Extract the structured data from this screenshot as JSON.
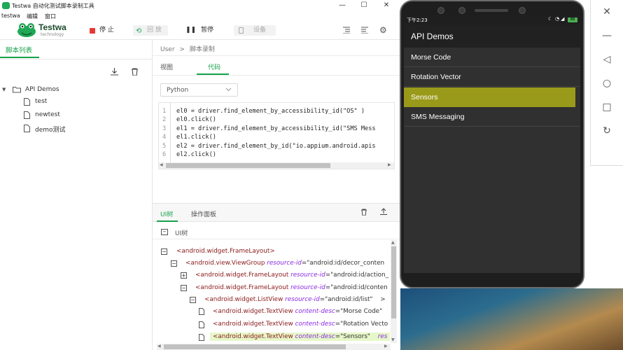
{
  "window": {
    "title": "Testwa 自动化测试脚本录制工具",
    "min_glyph": "—",
    "max_glyph": "☐",
    "close_glyph": "✕"
  },
  "menu": [
    "testwa",
    "编辑",
    "窗口"
  ],
  "logo": {
    "name": "Testwa",
    "sub": "technology"
  },
  "toolbar": {
    "stop": "停 止",
    "replay": "回 放",
    "pause": "暂停",
    "device": "设备"
  },
  "left": {
    "tab": "脚本列表",
    "tree_root": "API Demos",
    "files": [
      "test",
      "newtest",
      "demo测试"
    ]
  },
  "main": {
    "breadcrumb": {
      "root": "User",
      "sep": ">",
      "current": "脚本录制"
    },
    "tabs": [
      "视图",
      "代码"
    ],
    "active_tab": "代码",
    "language": "Python",
    "code_lines": [
      "el0 = driver.find_element_by_accessibility_id(\"OS\" )",
      "el0.click()",
      "el1 = driver.find_element_by_accessibility_id(\"SMS Mess",
      "el1.click()",
      "el2 = driver.find_element_by_id(\"io.appium.android.apis",
      "el2.click()"
    ],
    "line_numbers": [
      "1",
      "2",
      "3",
      "4",
      "5",
      "6"
    ]
  },
  "bottom": {
    "tabs": [
      "UI树",
      "操作面板"
    ],
    "panel_label": "UI树",
    "tree": [
      {
        "tag": "<android.widget.FrameLayout>",
        "attr": "",
        "val": "",
        "toggle": "−"
      },
      {
        "tag": "<android.view.ViewGroup",
        "attr": "resource-id",
        "val": "=\"android:id/decor_conten",
        "toggle": "−"
      },
      {
        "tag": "<android.widget.FrameLayout",
        "attr": "resource-id",
        "val": "=\"android:id/action_",
        "toggle": "+"
      },
      {
        "tag": "<android.widget.FrameLayout",
        "attr": "resource-id",
        "val": "=\"android:id/conten",
        "toggle": "−"
      },
      {
        "tag": "<android.widget.ListView",
        "attr": "resource-id",
        "val": "=\"android:id/list\"",
        "toggle": "−",
        "tail": ">"
      },
      {
        "tag": "<android.widget.TextView",
        "attr": "content-desc",
        "val": "=\"Morse Code\"",
        "toggle": ""
      },
      {
        "tag": "<android.widget.TextView",
        "attr": "content-desc",
        "val": "=\"Rotation Vecto",
        "toggle": ""
      },
      {
        "tag": "<android.widget.TextView",
        "attr": "content-desc",
        "val": "=\"Sensors\"",
        "toggle": "",
        "tail": "res"
      }
    ]
  },
  "phone": {
    "status_time": "下午2:23",
    "battery": "88",
    "app_title": "API Demos",
    "items": [
      "Morse Code",
      "Rotation Vector",
      "Sensors",
      "SMS Messaging"
    ],
    "selected_item": "Sensors"
  },
  "colors": {
    "accent_green": "#17a34a",
    "selected_item": "#9a9a1a",
    "stop_red": "#e53935",
    "tree_highlight": "#e6f7c9",
    "tag_color": "#8b1a1a",
    "attr_color": "#8a2be2"
  }
}
